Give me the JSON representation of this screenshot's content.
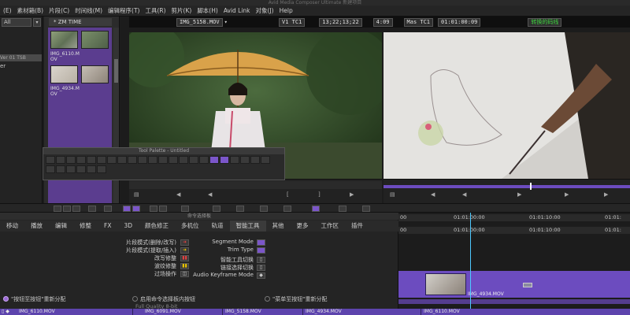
{
  "window": {
    "title": "Avid Media Composer Ultimate 新建项目"
  },
  "menubar": {
    "items": [
      "(E)",
      "素材箱(B)",
      "片段(C)",
      "时间线(M)",
      "编辑程序(T)",
      "工具(R)",
      "剪片(K)",
      "脚本(H)",
      "Avid Link",
      "对象(J)",
      "Help"
    ]
  },
  "left_bin": {
    "selector": "All",
    "selected_item": "Ver 01 TSB",
    "item": "er"
  },
  "bin": {
    "tab": "* ZM TIME",
    "clips": [
      {
        "label_line1": "IMG_6110.M",
        "label_line2": "OV"
      },
      {
        "label_line1": "IMG_4934.M",
        "label_line2": "OV"
      },
      {
        "label_line1": "",
        "label_line2": ""
      },
      {
        "label_line1": "",
        "label_line2": ""
      }
    ]
  },
  "source_monitor": {
    "clip_name": "IMG_5158.MOV",
    "menu_icon": "chevron-down-icon"
  },
  "record_monitor": {
    "track": "V1 TC1",
    "timecode": "13;22;13;22",
    "duration": "4:09",
    "mas": "Mas TC1",
    "mas_tc": "01:01:00:09",
    "sequence_name": "转换的码线"
  },
  "tool_palette": {
    "title": "Tool Palette - Untitled"
  },
  "command_palette": {
    "title": "命令选择板",
    "tabs": [
      "移动",
      "播放",
      "编辑",
      "修整",
      "FX",
      "3D",
      "颜色修正",
      "多机位",
      "轨道",
      "智能工具",
      "其他",
      "更多",
      "工作区",
      "插件"
    ],
    "left_rows": [
      "片段模式(删除/改写)",
      "片段模式(提取/插入)",
      "改写修整",
      "波纹修整",
      "过场操作"
    ],
    "right_rows": [
      "Segment Mode",
      "Trim Type",
      "智能工具切换",
      "链接选择切换",
      "Audio Keyframe Mode"
    ],
    "footer": {
      "option1": "\"按钮至按钮\"重新分配",
      "option2": "启用命令选择板内按钮",
      "option3": "\"菜单至按钮\"重新分配",
      "status": "Full Quality 8-bit"
    }
  },
  "timeline": {
    "ruler_ticks": [
      "00",
      "01:01:00:00",
      "01:01:10:00",
      "01:01:"
    ],
    "clips": [
      {
        "name": "IMG_4934.MOV"
      }
    ]
  },
  "bottom_track": {
    "clips": [
      "IMG_6110.MOV",
      "IMG_6091.MOV",
      "IMG_5158.MOV",
      "IMG_4934.MOV",
      "IMG_6110.MOV"
    ]
  }
}
